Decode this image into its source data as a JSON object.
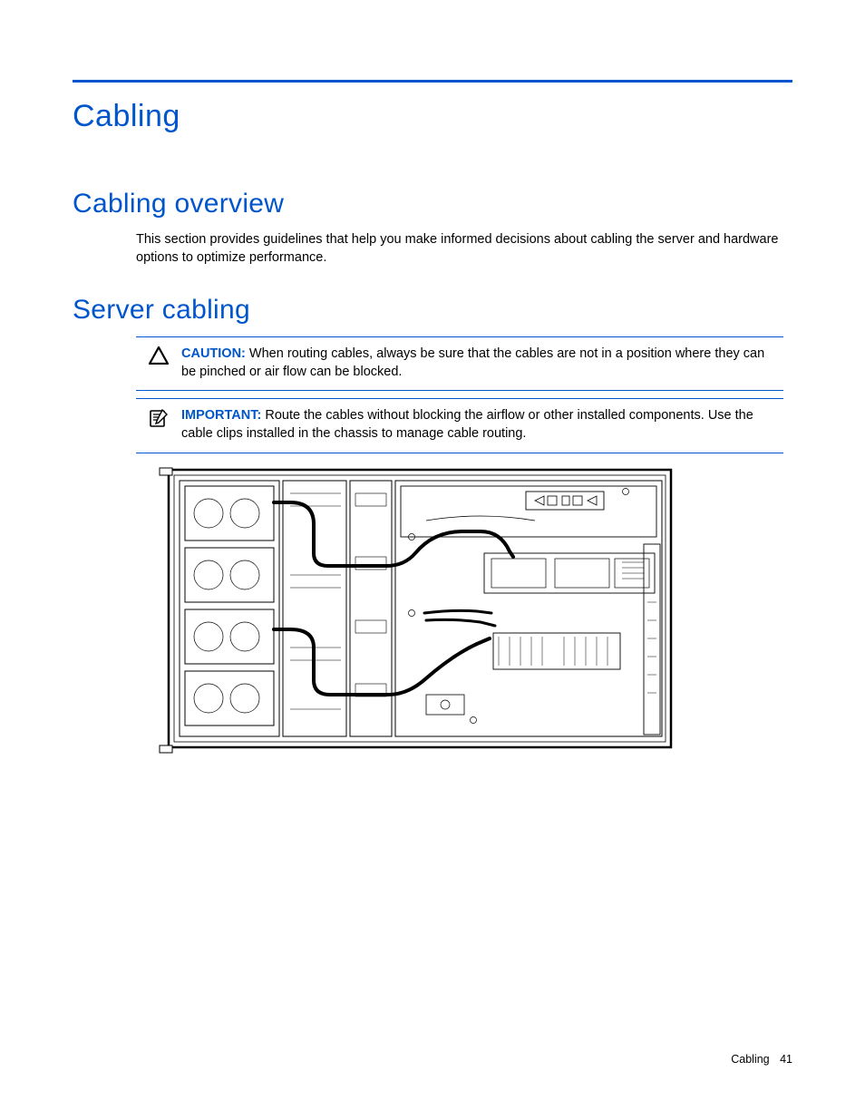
{
  "page_title": "Cabling",
  "sections": {
    "overview": {
      "heading": "Cabling overview",
      "paragraph": "This section provides guidelines that help you make informed decisions about cabling the server and hardware options to optimize performance."
    },
    "server_cabling": {
      "heading": "Server cabling",
      "caution_label": "CAUTION:",
      "caution_text": "  When routing cables, always be sure that the cables are not in a position where they can be pinched or air flow can be blocked.",
      "important_label": "IMPORTANT:",
      "important_text": "  Route the cables without blocking the airflow or other installed components. Use the cable clips installed in the chassis to manage cable routing."
    }
  },
  "footer": {
    "section": "Cabling",
    "page_number": "41"
  }
}
